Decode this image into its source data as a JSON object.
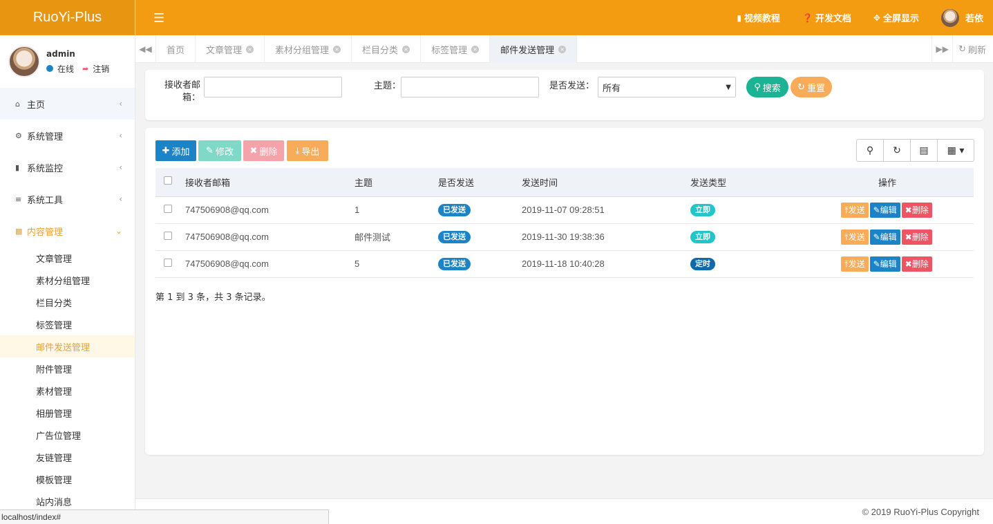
{
  "app": {
    "logo": "RuoYi-Plus"
  },
  "user": {
    "name": "admin",
    "status": "在线",
    "logout": "注销"
  },
  "sidebar": {
    "items": [
      {
        "label": "主页",
        "icon": "home-icon"
      },
      {
        "label": "系统管理",
        "icon": "gear-icon"
      },
      {
        "label": "系统监控",
        "icon": "video-icon"
      },
      {
        "label": "系统工具",
        "icon": "bars-icon"
      },
      {
        "label": "内容管理",
        "icon": "id-card-icon"
      }
    ],
    "subitems": [
      "文章管理",
      "素材分组管理",
      "栏目分类",
      "标签管理",
      "邮件发送管理",
      "附件管理",
      "素材管理",
      "相册管理",
      "广告位管理",
      "友链管理",
      "模板管理",
      "站内消息"
    ]
  },
  "header": {
    "video_tutorial": "视频教程",
    "dev_docs": "开发文档",
    "fullscreen": "全屏显示",
    "user_name": "若依"
  },
  "tabs": [
    {
      "label": "首页",
      "closable": false
    },
    {
      "label": "文章管理",
      "closable": true
    },
    {
      "label": "素材分组管理",
      "closable": true
    },
    {
      "label": "栏目分类",
      "closable": true
    },
    {
      "label": "标签管理",
      "closable": true
    },
    {
      "label": "邮件发送管理",
      "closable": true,
      "active": true
    }
  ],
  "tab_refresh": "刷新",
  "search": {
    "email_label_line1": "接收者邮",
    "email_label_line2": "箱：",
    "email_value": "",
    "subject_label": "主题：",
    "subject_value": "",
    "sent_label": "是否发送：",
    "sent_value": "所有",
    "search_btn": "搜索",
    "reset_btn": "重置"
  },
  "toolbar": {
    "add": "添加",
    "edit": "修改",
    "delete": "删除",
    "export": "导出"
  },
  "table": {
    "headers": [
      "接收者邮箱",
      "主题",
      "是否发送",
      "发送时间",
      "发送类型",
      "操作"
    ],
    "rows": [
      {
        "email": "747506908@qq.com",
        "subject": "1",
        "sent": "已发送",
        "time": "2019-11-07 09:28:51",
        "type": "立即"
      },
      {
        "email": "747506908@qq.com",
        "subject": "邮件测试",
        "sent": "已发送",
        "time": "2019-11-30 19:38:36",
        "type": "立即"
      },
      {
        "email": "747506908@qq.com",
        "subject": "5",
        "sent": "已发送",
        "time": "2019-11-18 10:40:28",
        "type": "定时"
      }
    ],
    "op_send": "发送",
    "op_edit": "编辑",
    "op_delete": "删除"
  },
  "pagination": "第 1 到 3 条，共 3 条记录。",
  "footer": {
    "copyright": "© 2019 RuoYi-Plus Copyright"
  },
  "statusbar": "localhost/index#",
  "colors": {
    "brand": "#f39c12",
    "primary": "#1c84c6",
    "info": "#23c6c8",
    "warning": "#f8ac59",
    "danger": "#ed5565",
    "success": "#1ab394"
  }
}
